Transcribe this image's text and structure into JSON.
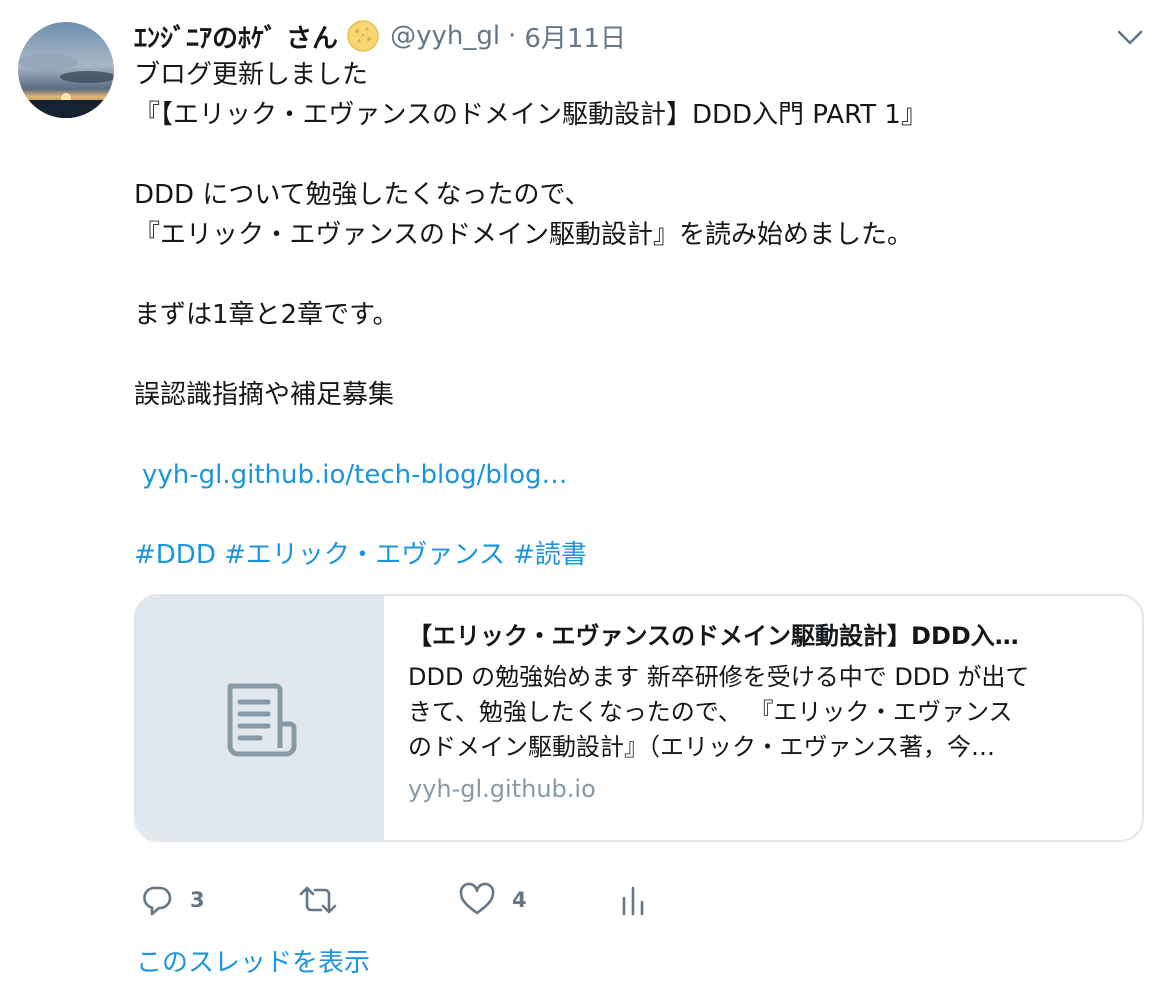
{
  "tweet": {
    "display_name": "ｴﾝｼﾞﾆｱのﾎｹﾞ さん",
    "handle": "@yyh_gl",
    "separator": "·",
    "time": "6月11日",
    "icons": {
      "badge": "cookie-badge-icon",
      "caret": "chevron-down-icon"
    },
    "text_lines": [
      "ブログ更新しました",
      "『【エリック・エヴァンスのドメイン駆動設計】DDD入門 PART 1』",
      "",
      "DDD について勉強したくなったので、",
      "『エリック・エヴァンスのドメイン駆動設計』を読み始めました。",
      "",
      "まずは1章と2章です。",
      "",
      "誤認識指摘や補足募集",
      ""
    ],
    "link_text": "yyh-gl.github.io/tech-blog/blog…",
    "hashtags": [
      "#DDD",
      "#エリック・エヴァンス",
      "#読書"
    ]
  },
  "card": {
    "title": "【エリック・エヴァンスのドメイン駆動設計】DDD入…",
    "description_lines": [
      "DDD の勉強始めます 新卒研修を受ける中で DDD が出て",
      "きて、勉強したくなったので、 『エリック・エヴァンス",
      "のドメイン駆動設計』（エリック・エヴァンス著，今…"
    ],
    "domain": "yyh-gl.github.io",
    "thumb_icon": "document-icon"
  },
  "actions": {
    "reply": {
      "icon": "reply-icon",
      "count": "3"
    },
    "retweet": {
      "icon": "retweet-icon",
      "count": ""
    },
    "like": {
      "icon": "heart-icon",
      "count": "4"
    },
    "analytics": {
      "icon": "analytics-icon"
    }
  },
  "thread_link": "このスレッドを表示",
  "colors": {
    "link": "#1b95e0",
    "secondary": "#657786",
    "border": "#e1e8ed"
  }
}
